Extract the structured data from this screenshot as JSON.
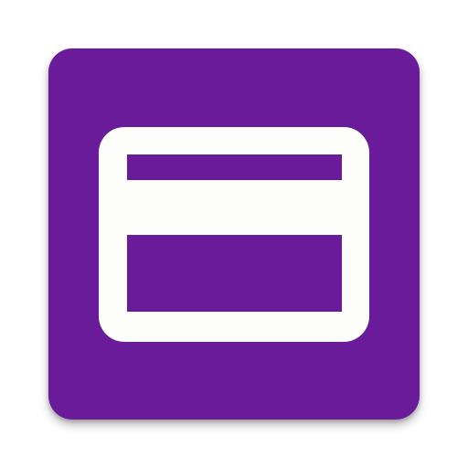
{
  "app_icon": {
    "icon": "credit-card-icon",
    "background_color": "#6a1b9a",
    "glyph_color": "#fdfdfb"
  }
}
